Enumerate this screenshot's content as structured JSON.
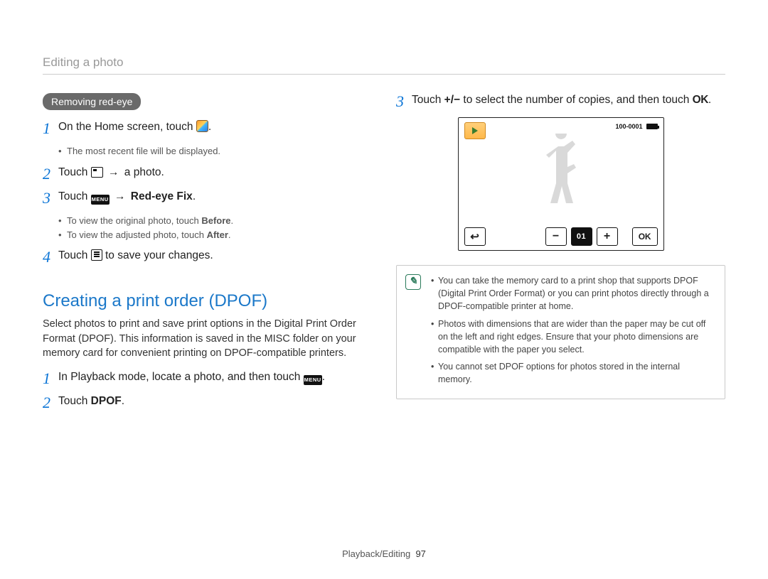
{
  "breadcrumb": "Editing a photo",
  "left": {
    "pill": "Removing red-eye",
    "step1": {
      "text_a": "On the Home screen, touch ",
      "text_b": "."
    },
    "step1_sub1": "The most recent file will be displayed.",
    "step2": {
      "text_a": "Touch ",
      "text_b": " a photo."
    },
    "step3": {
      "text_a": "Touch ",
      "bold_b": "Red-eye Fix",
      "text_c": "."
    },
    "step3_sub1_a": "To view the original photo, touch ",
    "step3_sub1_bold": "Before",
    "step3_sub1_c": ".",
    "step3_sub2_a": "To view the adjusted photo, touch ",
    "step3_sub2_bold": "After",
    "step3_sub2_c": ".",
    "step4": {
      "text_a": "Touch ",
      "text_b": " to save your changes."
    },
    "heading": "Creating a print order (DPOF)",
    "body": "Select photos to print and save print options in the Digital Print Order Format (DPOF). This information is saved in the MISC folder on your memory card for convenient printing on DPOF-compatible printers.",
    "dpof_step1": {
      "text_a": "In Playback mode, locate a photo, and then touch ",
      "text_b": "."
    },
    "dpof_step2": {
      "text_a": "Touch ",
      "bold_b": "DPOF",
      "text_c": "."
    }
  },
  "right": {
    "step3": {
      "text_a": "Touch ",
      "plusminus": "+/−",
      "text_b": " to select the number of copies, and then touch ",
      "ok": "OK",
      "text_c": "."
    },
    "device": {
      "file_counter": "100-0001",
      "count_value": "01",
      "ok_label": "OK"
    },
    "note1": "You can take the memory card to a print shop that supports DPOF (Digital Print Order Format) or you can print photos directly through a DPOF-compatible printer at home.",
    "note2": "Photos with dimensions that are wider than the paper may be cut off on the left and right edges. Ensure that your photo dimensions are compatible with the paper you select.",
    "note3": "You cannot set DPOF options for photos stored in the internal memory."
  },
  "icons": {
    "arrow": "→",
    "menu_label": "MENU",
    "back_glyph": "↩"
  },
  "footer": {
    "section": "Playback/Editing",
    "page": "97"
  }
}
